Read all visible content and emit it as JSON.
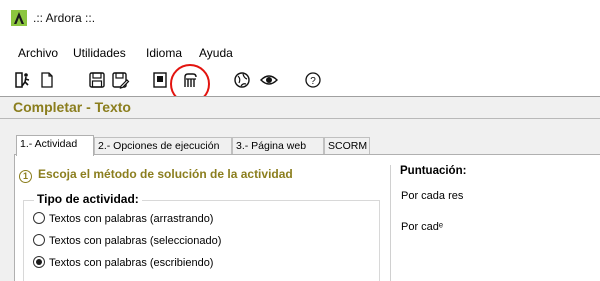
{
  "window": {
    "title": ".:: Ardora ::."
  },
  "menu": {
    "items": [
      "Archivo",
      "Utilidades",
      "Idioma",
      "Ayuda"
    ]
  },
  "toolbar": {
    "icons": [
      "exit-icon",
      "new-file-icon",
      "save-icon",
      "save-as-icon",
      "export-icon",
      "templates-icon",
      "web-icon",
      "preview-icon",
      "help-icon"
    ]
  },
  "header": {
    "title": "Completar - Texto"
  },
  "tabs": [
    {
      "label": "1.- Actividad",
      "active": true
    },
    {
      "label": "2.- Opciones de ejecución",
      "active": false
    },
    {
      "label": "3.- Página web",
      "active": false
    },
    {
      "label": "SCORM",
      "active": false
    }
  ],
  "step": {
    "number": "1",
    "text": "Escoja el método de solución de la actividad"
  },
  "activity_type": {
    "label": "Tipo de actividad:",
    "options": [
      {
        "label": "Textos con palabras (arrastrando)",
        "checked": false
      },
      {
        "label": "Textos con palabras (seleccionado)",
        "checked": false
      },
      {
        "label": "Textos con palabras (escribiendo)",
        "checked": true
      }
    ]
  },
  "scoring": {
    "title": "Puntuación:",
    "rows": [
      "Por cada res",
      "Por cadᵉ"
    ]
  },
  "colors": {
    "accent": "#8b7e1e",
    "highlight": "#e3140f",
    "brand": "#8cc63f"
  }
}
